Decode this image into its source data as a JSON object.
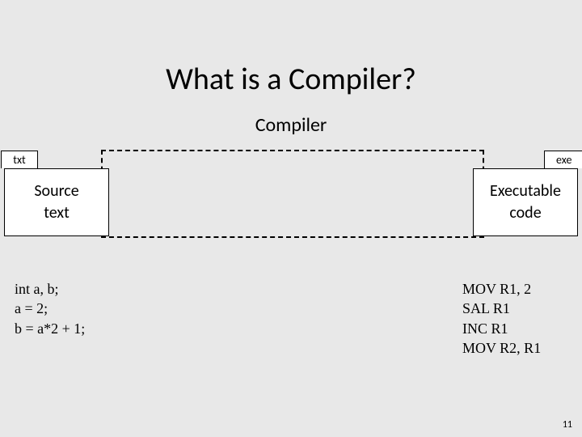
{
  "title": "What is a Compiler?",
  "subtitle": "Compiler",
  "left": {
    "tab": "txt",
    "line1": "Source",
    "line2": "text",
    "code": "int a, b;\na = 2;\nb = a*2 + 1;"
  },
  "right": {
    "tab": "exe",
    "line1": "Executable",
    "line2": "code",
    "code": "MOV R1, 2\nSAL R1\nINC R1\nMOV R2, R1"
  },
  "page": "11"
}
